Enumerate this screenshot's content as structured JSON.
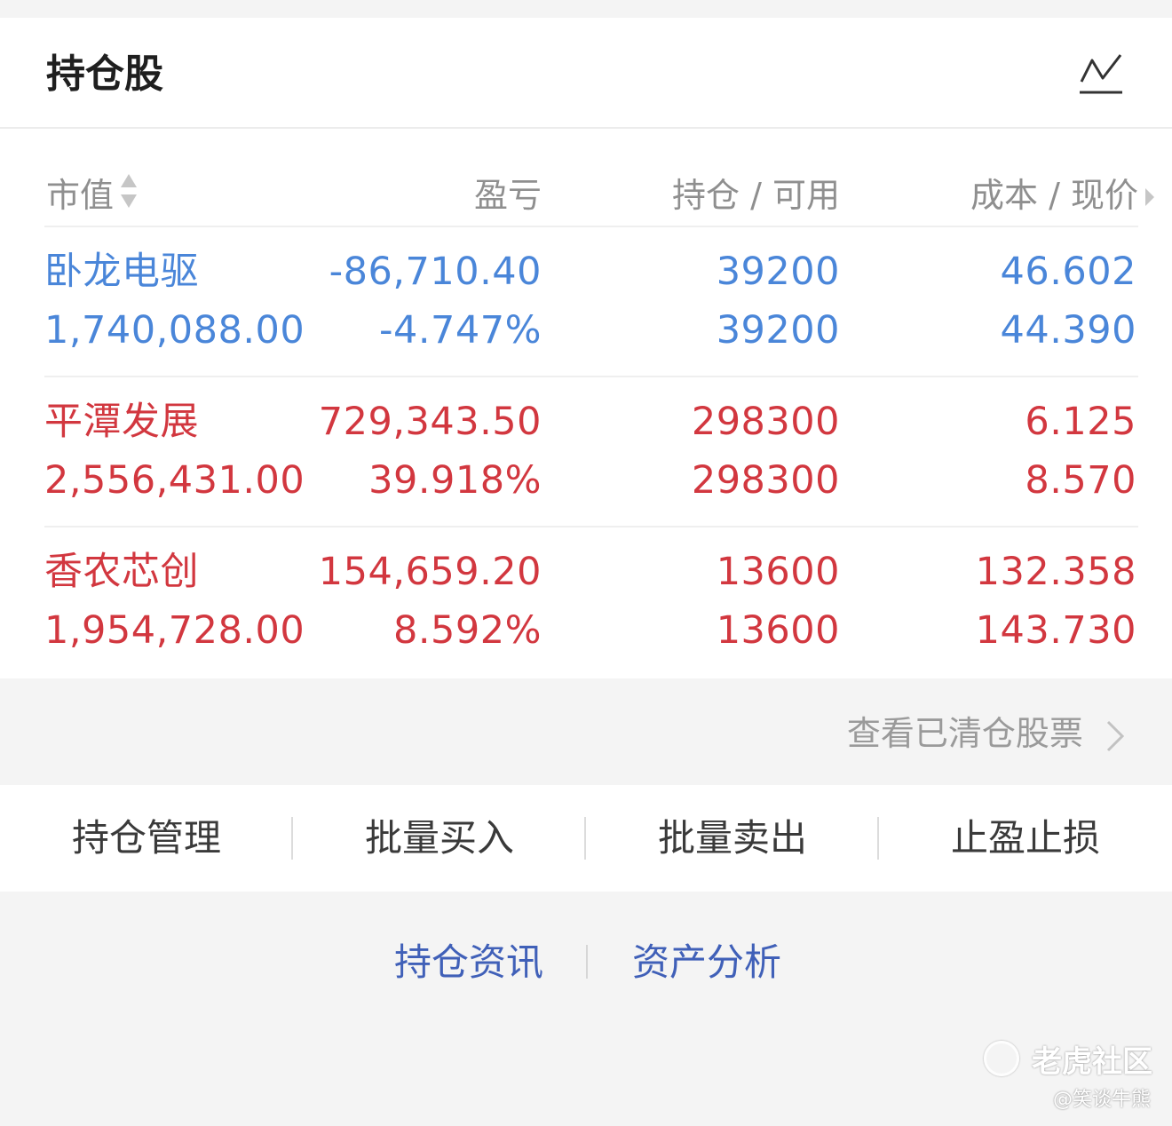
{
  "header": {
    "title": "持仓股",
    "chart_icon": "trend-chart-icon"
  },
  "columns": {
    "market_value": "市值",
    "profit_loss": "盈亏",
    "position": "持仓 / 可用",
    "cost_price": "成本 / 现价",
    "sort_icon": "sort-icon",
    "next_icon": "chevron-right-icon"
  },
  "holdings": [
    {
      "name": "卧龙电驱",
      "market_value": "1,740,088.00",
      "pl_amount": "-86,710.40",
      "pl_percent": "-4.747%",
      "position": "39200",
      "available": "39200",
      "cost": "46.602",
      "price": "44.390",
      "color": "#4a86d9"
    },
    {
      "name": "平潭发展",
      "market_value": "2,556,431.00",
      "pl_amount": "729,343.50",
      "pl_percent": "39.918%",
      "position": "298300",
      "available": "298300",
      "cost": "6.125",
      "price": "8.570",
      "color": "#d2373f"
    },
    {
      "name": "香农芯创",
      "market_value": "1,954,728.00",
      "pl_amount": "154,659.20",
      "pl_percent": "8.592%",
      "position": "13600",
      "available": "13600",
      "cost": "132.358",
      "price": "143.730",
      "color": "#d2373f"
    }
  ],
  "cleared_link": "查看已清仓股票",
  "actions": [
    "持仓管理",
    "批量买入",
    "批量卖出",
    "止盈止损"
  ],
  "bottom_links": [
    "持仓资讯",
    "资产分析"
  ],
  "watermark": {
    "brand": "老虎社区",
    "author": "@笑谈牛熊"
  },
  "colors": {
    "gain": "#d2373f",
    "loss": "#4a86d9",
    "link": "#4060b8"
  }
}
